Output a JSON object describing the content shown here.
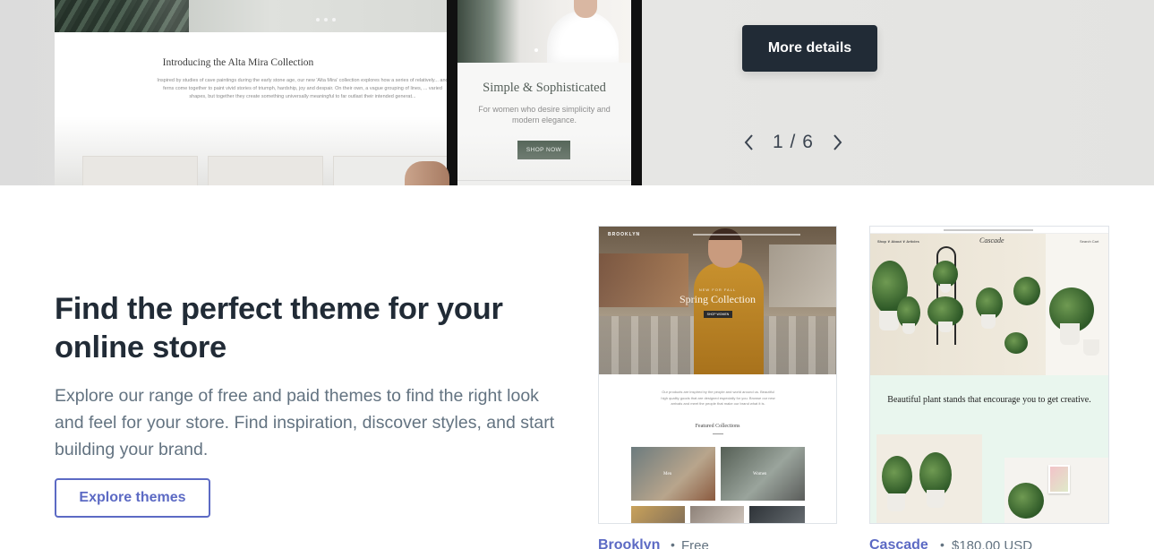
{
  "hero": {
    "desktop_preview": {
      "title": "Introducing the Alta Mira Collection",
      "copy": "Inspired by studies of cave paintings during the early stone age, our new 'Alta Mira' collection explores how a series of relatively... and ferns come together to paint vivid stories of triumph, hardship, joy and despair. On their own, a vague grouping of lines, ... varied shapes, but together they create something universally meaningful to far outlast their intended generat..."
    },
    "mobile_preview": {
      "title": "Simple & Sophisticated",
      "copy": "For women who desire simplicity and modern elegance.",
      "button": "SHOP NOW"
    },
    "more_details_label": "More details",
    "pager": {
      "current": "1",
      "separator": "/",
      "total": "6"
    }
  },
  "intro": {
    "heading": "Find the perfect theme for your online store",
    "subtext": "Explore our range of free and paid themes to find the right look and feel for your store. Find inspiration, discover styles, and start building your brand.",
    "cta_label": "Explore themes"
  },
  "themes": [
    {
      "name": "Brooklyn",
      "price": "Free",
      "preview": {
        "brand": "BROOKLYN",
        "kicker": "NEW FOR FALL",
        "title": "Spring Collection",
        "button": "SHOP WOMEN",
        "copy": "Our products are inspired by the people and world around us. Beautiful high quality goods that are designed especially for you. Browse our new arrivals and meet the people that make our brand what it is.",
        "featured": "Featured Collections",
        "tile_labels": [
          "Men",
          "Women"
        ]
      }
    },
    {
      "name": "Cascade",
      "price": "$180.00 USD",
      "preview": {
        "logo": "Cascade",
        "nav_left": "Shop ∨  About ∨  Articles",
        "nav_right": "Search  Cart",
        "headline": "Beautiful plant stands that encourage you to get creative."
      }
    }
  ],
  "colors": {
    "dark_button": "#212b36",
    "accent": "#5c6ac4",
    "subtext": "#637381"
  },
  "icons": [
    "chevron-left-icon",
    "chevron-right-icon"
  ]
}
